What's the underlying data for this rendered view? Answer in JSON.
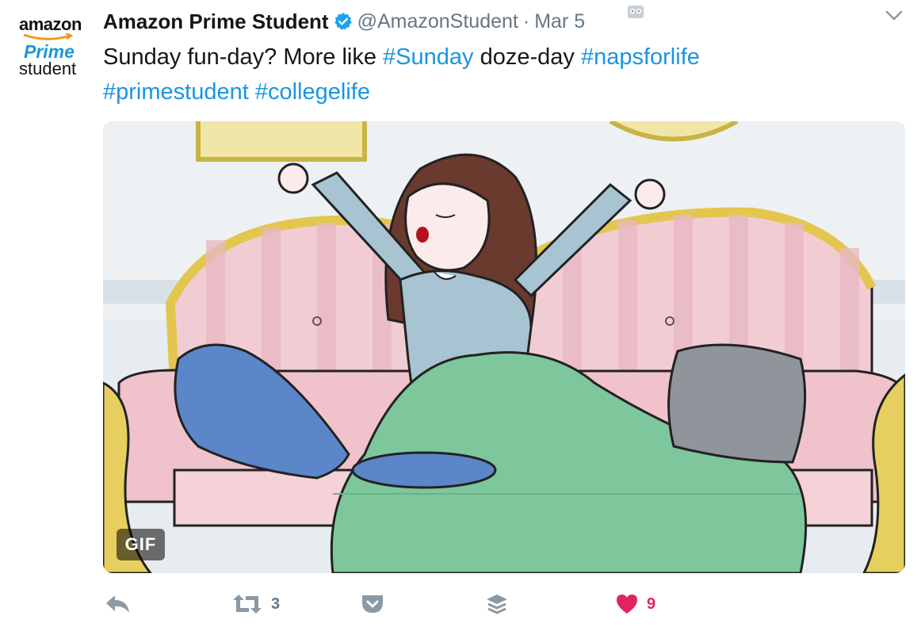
{
  "author": {
    "avatar_wordmark": "amazon",
    "avatar_prime": "Prime",
    "avatar_student": "student",
    "display_name": "Amazon Prime Student",
    "handle": "@AmazonStudent",
    "separator": "·",
    "date": "Mar 5",
    "verified": true
  },
  "tweet": {
    "text_1": "Sunday fun-day? More like ",
    "tag_1": "#Sunday",
    "text_2": " doze-day ",
    "tag_2": "#napsforlife",
    "tag_3": "#primestudent",
    "tag_4": "#collegelife"
  },
  "media": {
    "badge": "GIF"
  },
  "actions": {
    "reply_icon": "reply-icon",
    "retweet_icon": "retweet-icon",
    "retweet_count": "3",
    "pocket_icon": "pocket-icon",
    "buffer_icon": "buffer-icon",
    "like_icon": "heart-icon",
    "like_count": "9"
  },
  "colors": {
    "link": "#1b95e0",
    "verified": "#1da1f2",
    "muted": "#657786",
    "like": "#e0245e",
    "prime_blue": "#1a98d5"
  }
}
